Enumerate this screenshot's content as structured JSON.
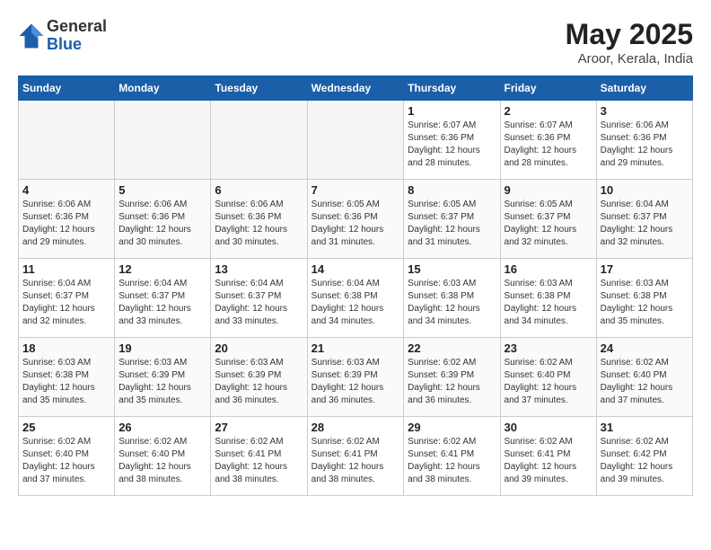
{
  "logo": {
    "general": "General",
    "blue": "Blue"
  },
  "title": "May 2025",
  "location": "Aroor, Kerala, India",
  "weekdays": [
    "Sunday",
    "Monday",
    "Tuesday",
    "Wednesday",
    "Thursday",
    "Friday",
    "Saturday"
  ],
  "weeks": [
    [
      {
        "day": "",
        "info": ""
      },
      {
        "day": "",
        "info": ""
      },
      {
        "day": "",
        "info": ""
      },
      {
        "day": "",
        "info": ""
      },
      {
        "day": "1",
        "info": "Sunrise: 6:07 AM\nSunset: 6:36 PM\nDaylight: 12 hours\nand 28 minutes."
      },
      {
        "day": "2",
        "info": "Sunrise: 6:07 AM\nSunset: 6:36 PM\nDaylight: 12 hours\nand 28 minutes."
      },
      {
        "day": "3",
        "info": "Sunrise: 6:06 AM\nSunset: 6:36 PM\nDaylight: 12 hours\nand 29 minutes."
      }
    ],
    [
      {
        "day": "4",
        "info": "Sunrise: 6:06 AM\nSunset: 6:36 PM\nDaylight: 12 hours\nand 29 minutes."
      },
      {
        "day": "5",
        "info": "Sunrise: 6:06 AM\nSunset: 6:36 PM\nDaylight: 12 hours\nand 30 minutes."
      },
      {
        "day": "6",
        "info": "Sunrise: 6:06 AM\nSunset: 6:36 PM\nDaylight: 12 hours\nand 30 minutes."
      },
      {
        "day": "7",
        "info": "Sunrise: 6:05 AM\nSunset: 6:36 PM\nDaylight: 12 hours\nand 31 minutes."
      },
      {
        "day": "8",
        "info": "Sunrise: 6:05 AM\nSunset: 6:37 PM\nDaylight: 12 hours\nand 31 minutes."
      },
      {
        "day": "9",
        "info": "Sunrise: 6:05 AM\nSunset: 6:37 PM\nDaylight: 12 hours\nand 32 minutes."
      },
      {
        "day": "10",
        "info": "Sunrise: 6:04 AM\nSunset: 6:37 PM\nDaylight: 12 hours\nand 32 minutes."
      }
    ],
    [
      {
        "day": "11",
        "info": "Sunrise: 6:04 AM\nSunset: 6:37 PM\nDaylight: 12 hours\nand 32 minutes."
      },
      {
        "day": "12",
        "info": "Sunrise: 6:04 AM\nSunset: 6:37 PM\nDaylight: 12 hours\nand 33 minutes."
      },
      {
        "day": "13",
        "info": "Sunrise: 6:04 AM\nSunset: 6:37 PM\nDaylight: 12 hours\nand 33 minutes."
      },
      {
        "day": "14",
        "info": "Sunrise: 6:04 AM\nSunset: 6:38 PM\nDaylight: 12 hours\nand 34 minutes."
      },
      {
        "day": "15",
        "info": "Sunrise: 6:03 AM\nSunset: 6:38 PM\nDaylight: 12 hours\nand 34 minutes."
      },
      {
        "day": "16",
        "info": "Sunrise: 6:03 AM\nSunset: 6:38 PM\nDaylight: 12 hours\nand 34 minutes."
      },
      {
        "day": "17",
        "info": "Sunrise: 6:03 AM\nSunset: 6:38 PM\nDaylight: 12 hours\nand 35 minutes."
      }
    ],
    [
      {
        "day": "18",
        "info": "Sunrise: 6:03 AM\nSunset: 6:38 PM\nDaylight: 12 hours\nand 35 minutes."
      },
      {
        "day": "19",
        "info": "Sunrise: 6:03 AM\nSunset: 6:39 PM\nDaylight: 12 hours\nand 35 minutes."
      },
      {
        "day": "20",
        "info": "Sunrise: 6:03 AM\nSunset: 6:39 PM\nDaylight: 12 hours\nand 36 minutes."
      },
      {
        "day": "21",
        "info": "Sunrise: 6:03 AM\nSunset: 6:39 PM\nDaylight: 12 hours\nand 36 minutes."
      },
      {
        "day": "22",
        "info": "Sunrise: 6:02 AM\nSunset: 6:39 PM\nDaylight: 12 hours\nand 36 minutes."
      },
      {
        "day": "23",
        "info": "Sunrise: 6:02 AM\nSunset: 6:40 PM\nDaylight: 12 hours\nand 37 minutes."
      },
      {
        "day": "24",
        "info": "Sunrise: 6:02 AM\nSunset: 6:40 PM\nDaylight: 12 hours\nand 37 minutes."
      }
    ],
    [
      {
        "day": "25",
        "info": "Sunrise: 6:02 AM\nSunset: 6:40 PM\nDaylight: 12 hours\nand 37 minutes."
      },
      {
        "day": "26",
        "info": "Sunrise: 6:02 AM\nSunset: 6:40 PM\nDaylight: 12 hours\nand 38 minutes."
      },
      {
        "day": "27",
        "info": "Sunrise: 6:02 AM\nSunset: 6:41 PM\nDaylight: 12 hours\nand 38 minutes."
      },
      {
        "day": "28",
        "info": "Sunrise: 6:02 AM\nSunset: 6:41 PM\nDaylight: 12 hours\nand 38 minutes."
      },
      {
        "day": "29",
        "info": "Sunrise: 6:02 AM\nSunset: 6:41 PM\nDaylight: 12 hours\nand 38 minutes."
      },
      {
        "day": "30",
        "info": "Sunrise: 6:02 AM\nSunset: 6:41 PM\nDaylight: 12 hours\nand 39 minutes."
      },
      {
        "day": "31",
        "info": "Sunrise: 6:02 AM\nSunset: 6:42 PM\nDaylight: 12 hours\nand 39 minutes."
      }
    ]
  ]
}
